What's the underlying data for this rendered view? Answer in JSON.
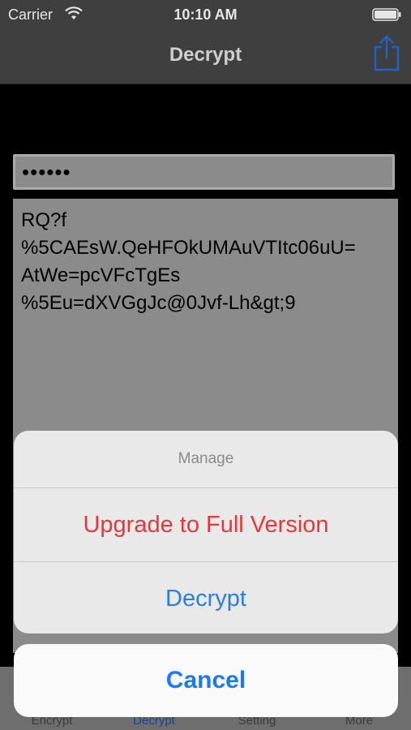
{
  "status_bar": {
    "carrier": "Carrier",
    "time": "10:10 AM"
  },
  "nav": {
    "title": "Decrypt",
    "share_icon": "share-icon"
  },
  "password": {
    "value": "••••••"
  },
  "content": {
    "text": "RQ?f\n%5CAEsW.QeHFOkUMAuVTItc06uU=\nAtWe=pcVFcTgEs\n%5Eu=dXVGgJc@0Jvf-Lh&gt;9"
  },
  "tabs": [
    {
      "label": "Encrypt",
      "active": false
    },
    {
      "label": "Decrypt",
      "active": true
    },
    {
      "label": "Setting",
      "active": false
    },
    {
      "label": "More",
      "active": false
    }
  ],
  "action_sheet": {
    "title": "Manage",
    "upgrade_label": "Upgrade to Full Version",
    "decrypt_label": "Decrypt",
    "cancel_label": "Cancel"
  },
  "colors": {
    "destructive": "#e8363a",
    "accent": "#2f7ddb",
    "nav_bg": "#3f3f3f"
  }
}
